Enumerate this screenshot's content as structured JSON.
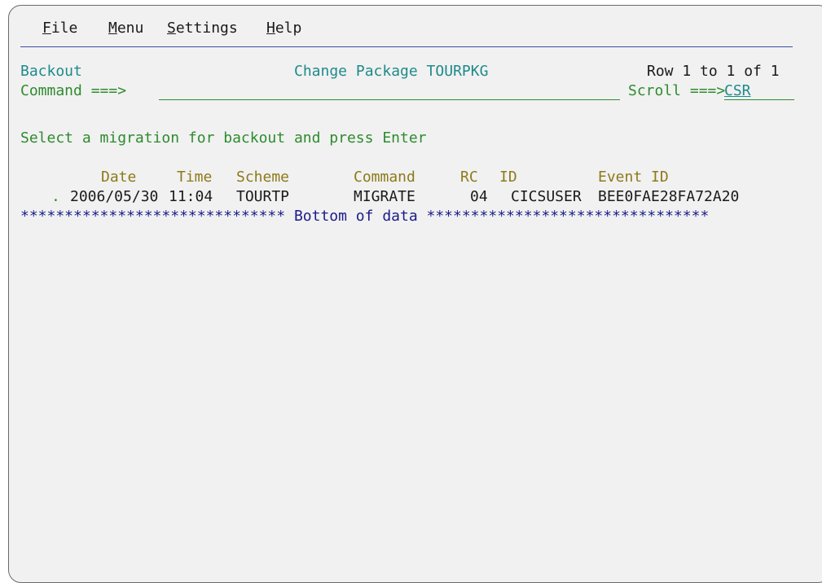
{
  "menu": {
    "items": [
      {
        "hotkey": "F",
        "rest": "ile"
      },
      {
        "hotkey": "M",
        "rest": "enu"
      },
      {
        "hotkey": "S",
        "rest": "ettings"
      },
      {
        "hotkey": "H",
        "rest": "elp"
      }
    ]
  },
  "header": {
    "panel_id": "Backout",
    "title": "Change Package TOURPKG",
    "row_info": "Row 1 to 1 of 1",
    "command_label": "Command ===>",
    "command_value": "",
    "scroll_label": "Scroll ===>",
    "scroll_value": "CSR"
  },
  "instruction": "Select a migration for backout and press Enter",
  "table": {
    "columns": {
      "date": "Date",
      "time": "Time",
      "scheme": "Scheme",
      "command": "Command",
      "rc": "RC",
      "id": "ID",
      "event_id": "Event ID"
    },
    "rows": [
      {
        "sel": ".",
        "date": "2006/05/30",
        "time": "11:04",
        "scheme": "TOURTP",
        "command": "MIGRATE",
        "rc": "04",
        "id": "CICSUSER",
        "event_id": "BEE0FAE28FA72A20"
      }
    ],
    "bottom_marker": "****************************** Bottom of data ********************************"
  },
  "colors": {
    "background": "#f1f1f1",
    "teal": "#1f8a8a",
    "green": "#2e8b2e",
    "olive": "#8d7a1a",
    "navy": "#1b1b8a",
    "separator": "#3d4fa8"
  }
}
